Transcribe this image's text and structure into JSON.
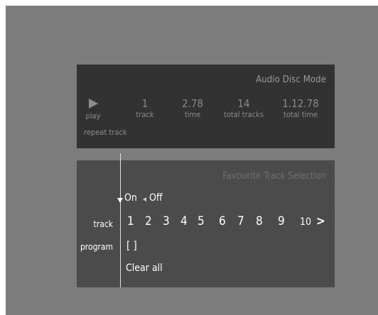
{
  "audio_panel": {
    "title": "Audio Disc Mode",
    "play_label": "play",
    "track": {
      "value": "1",
      "label": "track"
    },
    "time": {
      "value": "2.78",
      "label": "time"
    },
    "total_tracks": {
      "value": "14",
      "label": "total tracks"
    },
    "total_time": {
      "value": "1.12.78",
      "label": "total time"
    },
    "repeat_label": "repeat track"
  },
  "favourite_panel": {
    "title": "Favourite Track Selection",
    "toggle_on": "On",
    "toggle_off": "Off",
    "track_label": "track",
    "program_label": "program",
    "tracks": [
      "1",
      "2",
      "3",
      "4",
      "5",
      "6",
      "7",
      "8",
      "9",
      "10"
    ],
    "next_symbol": ">",
    "program_value": "[ ]",
    "clear_all": "Clear all"
  },
  "icons": [
    "play-icon",
    "down-arrow-icon",
    "left-arrow-icon"
  ]
}
